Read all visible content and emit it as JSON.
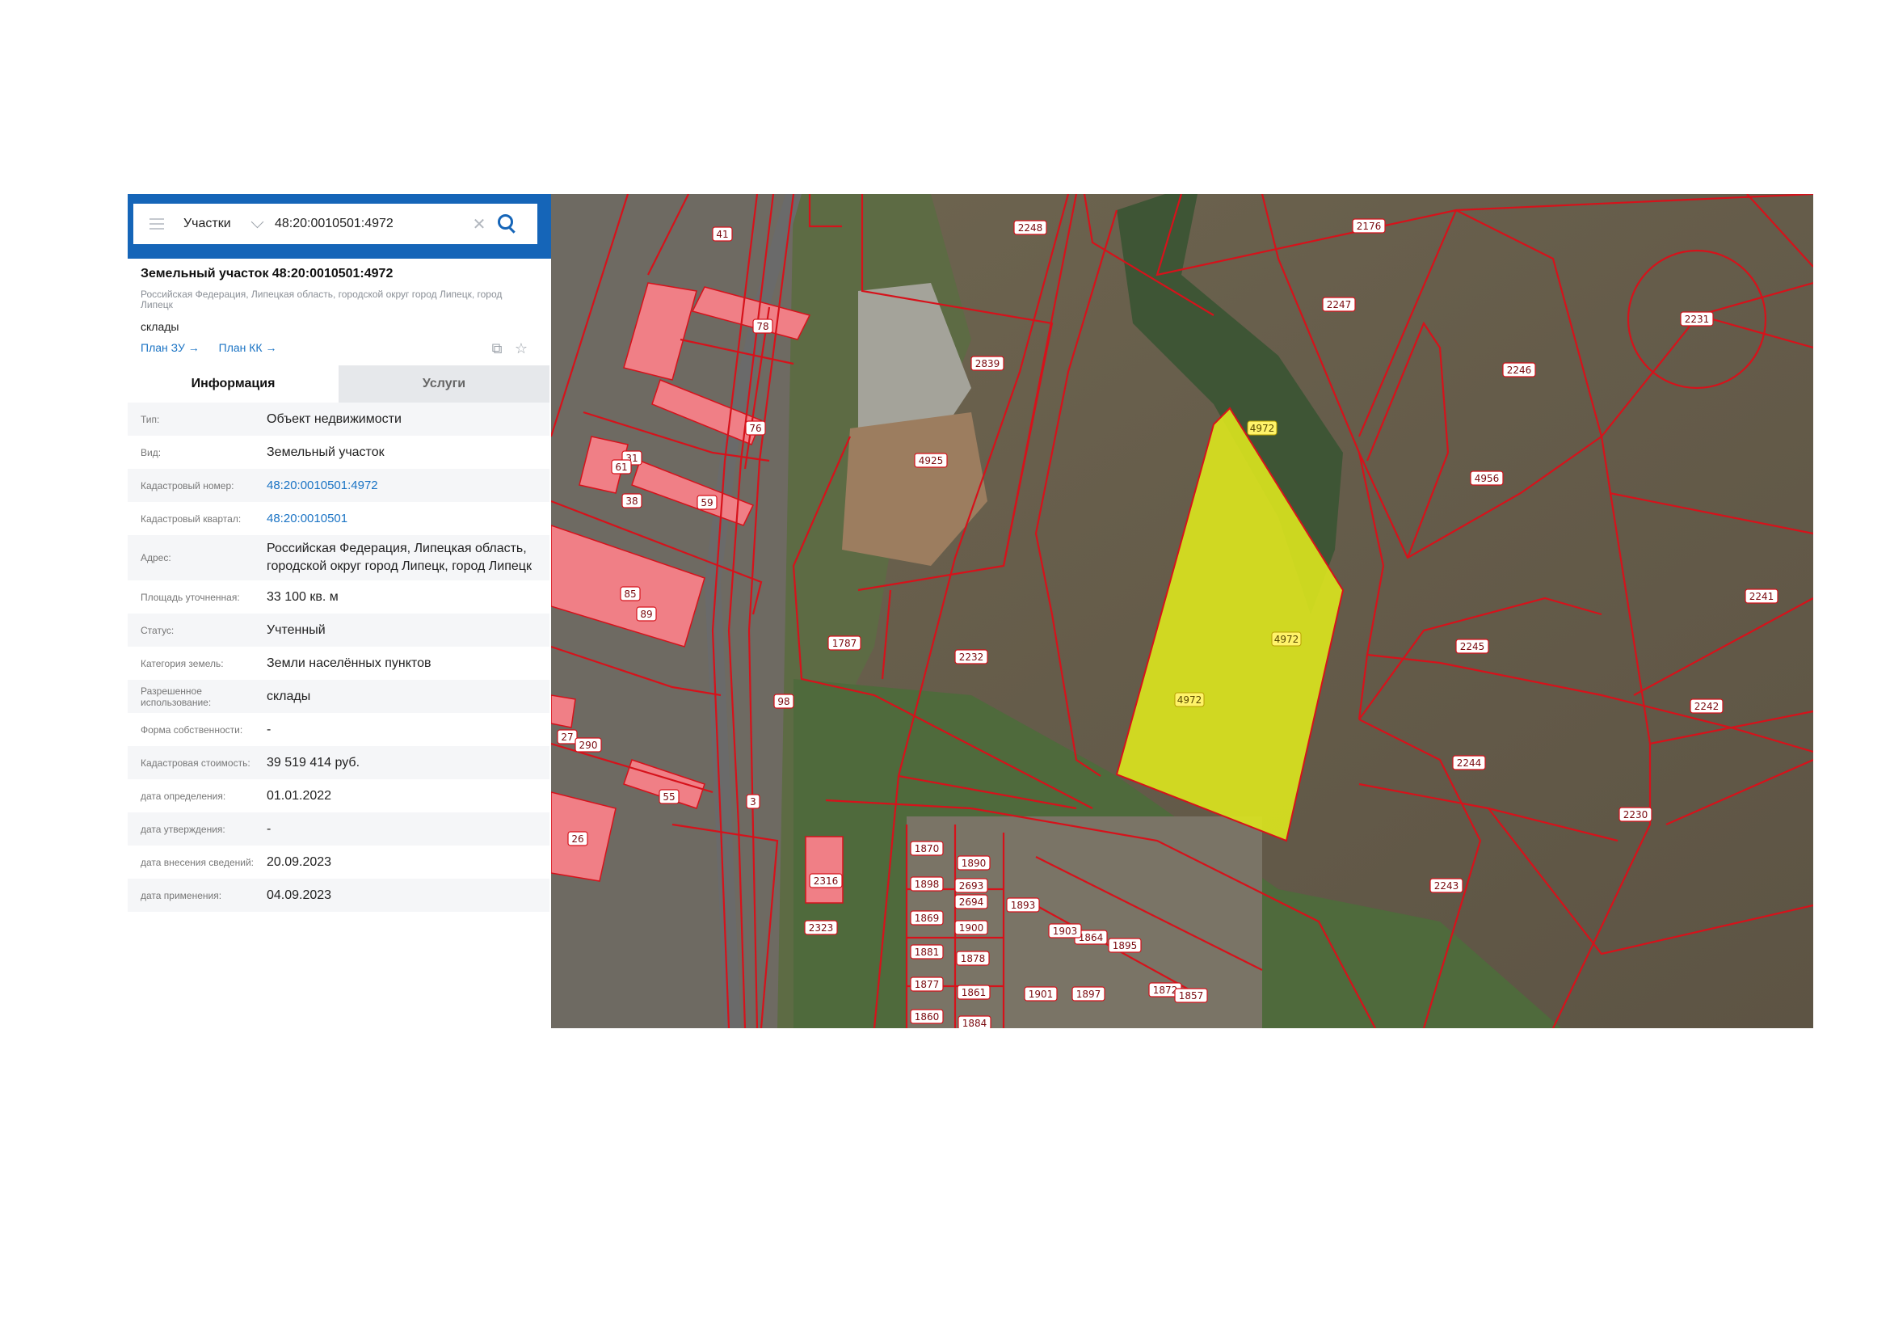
{
  "search": {
    "category": "Участки",
    "query": "48:20:0010501:4972"
  },
  "parcel": {
    "title": "Земельный участок 48:20:0010501:4972",
    "address_short": "Российская Федерация, Липецкая область, городской округ город Липецк, город Липецк",
    "purpose": "склады",
    "link_zu": "План ЗУ →",
    "link_kk": "План КК →"
  },
  "tabs": [
    {
      "label": "Информация",
      "active": true
    },
    {
      "label": "Услуги",
      "active": false
    }
  ],
  "info": [
    {
      "label": "Тип:",
      "value": "Объект недвижимости"
    },
    {
      "label": "Вид:",
      "value": "Земельный участок"
    },
    {
      "label": "Кадастровый номер:",
      "value": "48:20:0010501:4972",
      "link": true
    },
    {
      "label": "Кадастровый квартал:",
      "value": "48:20:0010501",
      "link": true
    },
    {
      "label": "Адрес:",
      "value": "Российская Федерация, Липецкая область, городской округ город Липецк, город Липецк"
    },
    {
      "label": "Площадь уточненная:",
      "value": "33 100 кв. м"
    },
    {
      "label": "Статус:",
      "value": "Учтенный"
    },
    {
      "label": "Категория земель:",
      "value": "Земли населённых пунктов"
    },
    {
      "label": "Разрешенное использование:",
      "value": "склады"
    },
    {
      "label": "Форма собственности:",
      "value": "-"
    },
    {
      "label": "Кадастровая стоимость:",
      "value": "39 519 414 руб."
    },
    {
      "label": "дата определения:",
      "value": "01.01.2022"
    },
    {
      "label": "дата утверждения:",
      "value": "-"
    },
    {
      "label": "дата внесения сведений:",
      "value": "20.09.2023"
    },
    {
      "label": "дата применения:",
      "value": "04.09.2023"
    }
  ],
  "map": {
    "selected_parcel": "4972",
    "parcel_labels": [
      "2248",
      "2176",
      "2247",
      "2231",
      "2246",
      "4956",
      "2241",
      "2245",
      "2242",
      "2244",
      "2230",
      "2243",
      "2839",
      "4925",
      "2232",
      "1787",
      "2323",
      "1893",
      "1898",
      "2693",
      "2694",
      "1869",
      "1900",
      "1881",
      "1878",
      "1877",
      "1861",
      "1860",
      "1884",
      "78",
      "76",
      "59",
      "85",
      "89",
      "31",
      "38",
      "61",
      "41",
      "26",
      "27",
      "290",
      "55",
      "3",
      "98",
      "2316",
      "1890",
      "1864",
      "1872",
      "1857",
      "1901",
      "1897",
      "1903",
      "1895",
      "1870"
    ],
    "colors": {
      "boundary": "#d6121b",
      "selected_fill": "#dce61e",
      "building": "#f07f86"
    }
  }
}
